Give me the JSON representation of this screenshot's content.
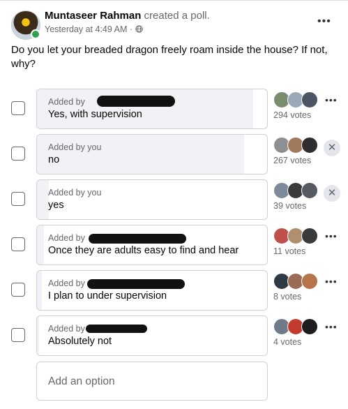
{
  "post": {
    "author": "Muntaseer Rahman",
    "action": "created a poll.",
    "timestamp": "Yesterday at 4:49 AM",
    "privacy_icon": "globe-icon",
    "more": "•••",
    "question": "Do you let your breaded dragon freely roam inside the house? If not, why?"
  },
  "poll": {
    "options": [
      {
        "added_by": "Added by",
        "label": "Yes, with supervision",
        "votes": "294 votes",
        "fill": 0.94,
        "control": "more",
        "control_text": "•••",
        "voter_colors": [
          "#7a8c6e",
          "#9aa9b8",
          "#4b5563"
        ]
      },
      {
        "added_by": "Added by you",
        "label": "no",
        "votes": "267 votes",
        "fill": 0.9,
        "control": "remove",
        "control_text": "✕",
        "voter_colors": [
          "#8d8f93",
          "#a07a5a",
          "#2f2f2f"
        ]
      },
      {
        "added_by": "Added by you",
        "label": "yes",
        "votes": "39 votes",
        "fill": 0.05,
        "control": "remove",
        "control_text": "✕",
        "voter_colors": [
          "#7c8a99",
          "#3b3b3b",
          "#555b61"
        ]
      },
      {
        "added_by": "Added by",
        "label": "Once they are adults easy to find and hear",
        "votes": "11 votes",
        "fill": 0.03,
        "control": "more",
        "control_text": "•••",
        "voter_colors": [
          "#c0504d",
          "#b08f6e",
          "#3a3a3a"
        ]
      },
      {
        "added_by": "Added by",
        "label": "I plan to under supervision",
        "votes": "8 votes",
        "fill": 0.02,
        "control": "more",
        "control_text": "•••",
        "voter_colors": [
          "#2e3a44",
          "#9a6b55",
          "#b5744a"
        ]
      },
      {
        "added_by": "Added by",
        "label": "Absolutely not",
        "votes": "4 votes",
        "fill": 0.01,
        "control": "more",
        "control_text": "•••",
        "voter_colors": [
          "#6f7b86",
          "#c23b2e",
          "#1e1e1e"
        ]
      }
    ],
    "add_option_placeholder": "Add an option"
  }
}
